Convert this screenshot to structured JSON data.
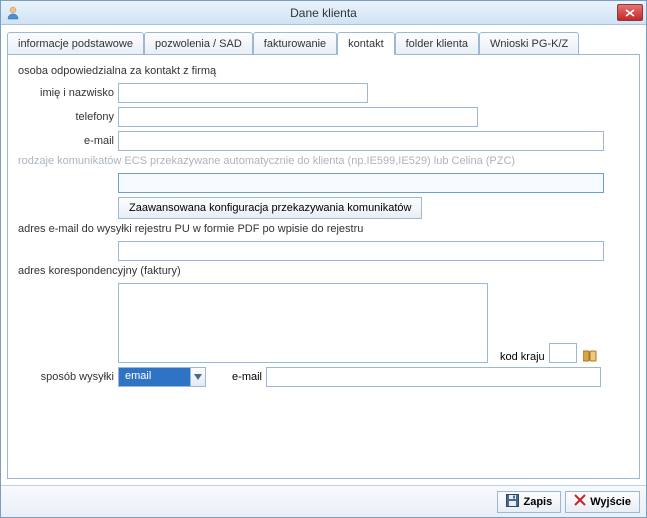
{
  "window": {
    "title": "Dane klienta"
  },
  "tabs": [
    {
      "label": "informacje podstawowe"
    },
    {
      "label": "pozwolenia / SAD"
    },
    {
      "label": "fakturowanie"
    },
    {
      "label": "kontakt"
    },
    {
      "label": "folder klienta"
    },
    {
      "label": "Wnioski PG-K/Z"
    }
  ],
  "kontakt": {
    "section1_label": "osoba odpowiedzialna za kontakt z firmą",
    "name_label": "imię i nazwisko",
    "name_value": "",
    "phones_label": "telefony",
    "phones_value": "",
    "email_label": "e-mail",
    "email_value": "",
    "section2_label": "rodzaje komunikatów ECS przekazywane automatycznie do klienta (np.IE599,IE529) lub Celina (PZC)",
    "ecs_value": "",
    "advanced_button": "Zaawansowana konfiguracja przekazywania komunikatów",
    "section3_label": "adres e-mail do wysyłki rejestru PU w formie PDF po wpisie do rejestru",
    "pu_email_value": "",
    "section4_label": "adres korespondencyjny (faktury)",
    "address_value": "",
    "country_label": "kod kraju",
    "country_value": "",
    "ship_label": "sposób wysyłki",
    "ship_value": "email",
    "ship_email_label": "e-mail",
    "ship_email_value": ""
  },
  "footer": {
    "save": "Zapis",
    "exit": "Wyjście"
  }
}
